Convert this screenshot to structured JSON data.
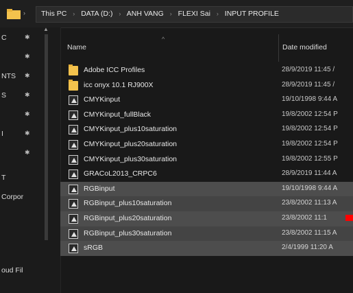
{
  "address_bar": {
    "breadcrumbs": [
      "This PC",
      "DATA (D:)",
      "ANH VANG",
      "FLEXI Sai",
      "INPUT PROFILE"
    ],
    "separator": "›"
  },
  "nav_pane": {
    "items": [
      {
        "label": "C",
        "pinned": true
      },
      {
        "label": "",
        "pinned": true
      },
      {
        "label": "NTS",
        "pinned": true
      },
      {
        "label": "S",
        "pinned": true
      },
      {
        "label": "",
        "pinned": true
      },
      {
        "label": "I",
        "pinned": true
      },
      {
        "label": "",
        "pinned": true
      },
      {
        "label": "T",
        "pinned": false
      },
      {
        "label": "Corpor",
        "pinned": false
      },
      {
        "label": "oud Fil",
        "pinned": false
      }
    ],
    "pin_glyph": "📌"
  },
  "columns": {
    "name": "Name",
    "date_modified": "Date modified"
  },
  "files": [
    {
      "name": "Adobe ICC Profiles",
      "date": "28/9/2019 11:45 /",
      "icon": "folder-icon",
      "selected": false
    },
    {
      "name": "icc onyx 10.1 RJ900X",
      "date": "28/9/2019 11:45 /",
      "icon": "folder-icon",
      "selected": false
    },
    {
      "name": "CMYKinput",
      "date": "19/10/1998 9:44 A",
      "icon": "icc-profile-icon",
      "selected": false
    },
    {
      "name": "CMYKinput_fullBlack",
      "date": "19/8/2002 12:54 P",
      "icon": "icc-profile-icon",
      "selected": false
    },
    {
      "name": "CMYKinput_plus10saturation",
      "date": "19/8/2002 12:54 P",
      "icon": "icc-profile-icon",
      "selected": false
    },
    {
      "name": "CMYKinput_plus20saturation",
      "date": "19/8/2002 12:54 P",
      "icon": "icc-profile-icon",
      "selected": false
    },
    {
      "name": "CMYKinput_plus30saturation",
      "date": "19/8/2002 12:55 P",
      "icon": "icc-profile-icon",
      "selected": false
    },
    {
      "name": "GRACoL2013_CRPC6",
      "date": "28/9/2019 11:44 A",
      "icon": "icc-profile-icon",
      "selected": false
    },
    {
      "name": "RGBinput",
      "date": "19/10/1998 9:44 A",
      "icon": "icc-profile-icon",
      "selected": true
    },
    {
      "name": "RGBinput_plus10saturation",
      "date": "23/8/2002 11:13 A",
      "icon": "icc-profile-icon",
      "selected": true
    },
    {
      "name": "RGBinput_plus20saturation",
      "date": "23/8/2002 11:1",
      "icon": "icc-profile-icon",
      "selected": true
    },
    {
      "name": "RGBinput_plus30saturation",
      "date": "23/8/2002 11:15 A",
      "icon": "icc-profile-icon",
      "selected": true
    },
    {
      "name": "sRGB",
      "date": "2/4/1999 11:20 A",
      "icon": "icc-profile-icon",
      "selected": true
    }
  ],
  "colors": {
    "background": "#191919",
    "selection": "#444444",
    "folder": "#f3c24d",
    "annotation_mark": "#ff0000"
  }
}
